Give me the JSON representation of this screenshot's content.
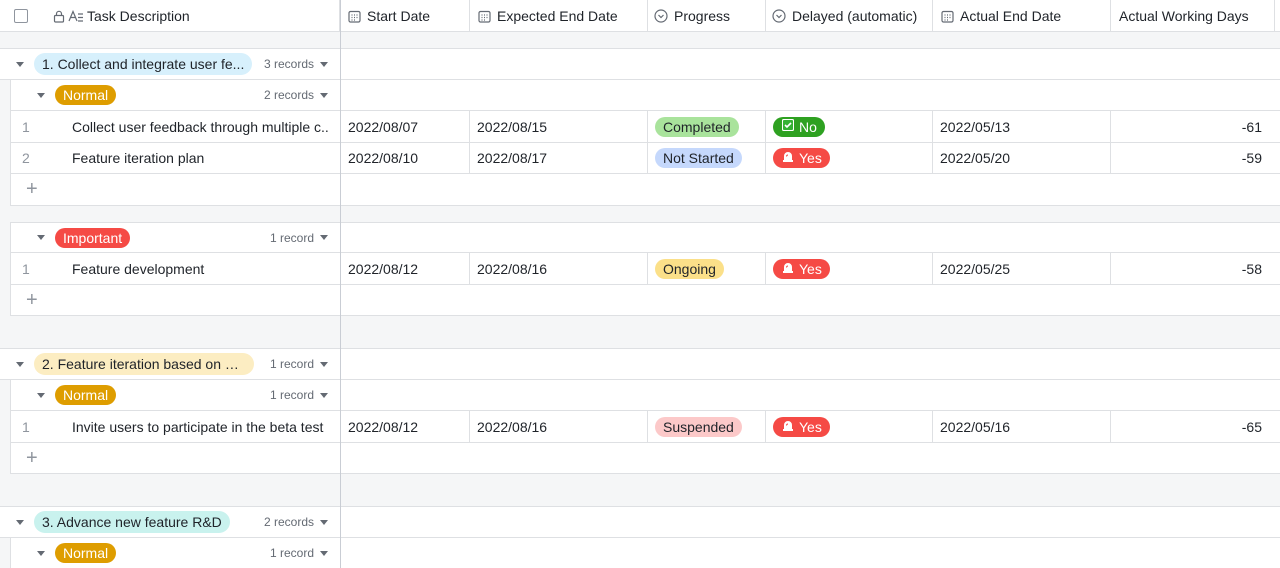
{
  "header": {
    "task_description": "Task Description",
    "start_date": "Start Date",
    "expected_end_date": "Expected End Date",
    "progress": "Progress",
    "delayed": "Delayed (automatic)",
    "actual_end_date": "Actual End Date",
    "actual_working_days": "Actual Working Days"
  },
  "groups": [
    {
      "label": "1. Collect and integrate user fe...",
      "count": "3 records",
      "color": "#d7f0fc",
      "subgroups": [
        {
          "priority": "Normal",
          "priority_color": "#de9d00",
          "count": "2 records",
          "records": [
            {
              "num": "1",
              "desc": "Collect user feedback through multiple c...",
              "start": "2022/08/07",
              "expected": "2022/08/15",
              "progress": "Completed",
              "delayed": "No",
              "actual_end": "2022/05/13",
              "working_days": "-61"
            },
            {
              "num": "2",
              "desc": "Feature iteration plan",
              "start": "2022/08/10",
              "expected": "2022/08/17",
              "progress": "Not Started",
              "delayed": "Yes",
              "actual_end": "2022/05/20",
              "working_days": "-59"
            }
          ]
        },
        {
          "priority": "Important",
          "priority_color": "#f54a45",
          "count": "1 record",
          "records": [
            {
              "num": "1",
              "desc": "Feature development",
              "start": "2022/08/12",
              "expected": "2022/08/16",
              "progress": "Ongoing",
              "delayed": "Yes",
              "actual_end": "2022/05/25",
              "working_days": "-58"
            }
          ]
        }
      ]
    },
    {
      "label": "2. Feature iteration based on us...",
      "count": "1 record",
      "color": "#fcedc2",
      "subgroups": [
        {
          "priority": "Normal",
          "priority_color": "#de9d00",
          "count": "1 record",
          "records": [
            {
              "num": "1",
              "desc": "Invite users to participate in the beta test",
              "start": "2022/08/12",
              "expected": "2022/08/16",
              "progress": "Suspended",
              "delayed": "Yes",
              "actual_end": "2022/05/16",
              "working_days": "-65"
            }
          ]
        }
      ]
    },
    {
      "label": "3. Advance new feature R&D",
      "count": "2 records",
      "color": "#c9f2ee",
      "subgroups": [
        {
          "priority": "Normal",
          "priority_color": "#de9d00",
          "count": "1 record",
          "records": []
        }
      ]
    }
  ],
  "colors": {
    "progress_completed": "#a9e39c",
    "progress_not_started": "#c5d8fc",
    "progress_ongoing": "#fbe089",
    "progress_suspended": "#fcc9c9",
    "delayed_no": "#2ea121",
    "delayed_yes": "#f54a45"
  },
  "icons": {
    "lock": "lock-icon",
    "text_type": "text-field-icon",
    "date": "calendar-icon",
    "single_select": "dropdown-circle-icon",
    "delayed_no": "check-box-icon",
    "delayed_yes": "siren-icon"
  }
}
